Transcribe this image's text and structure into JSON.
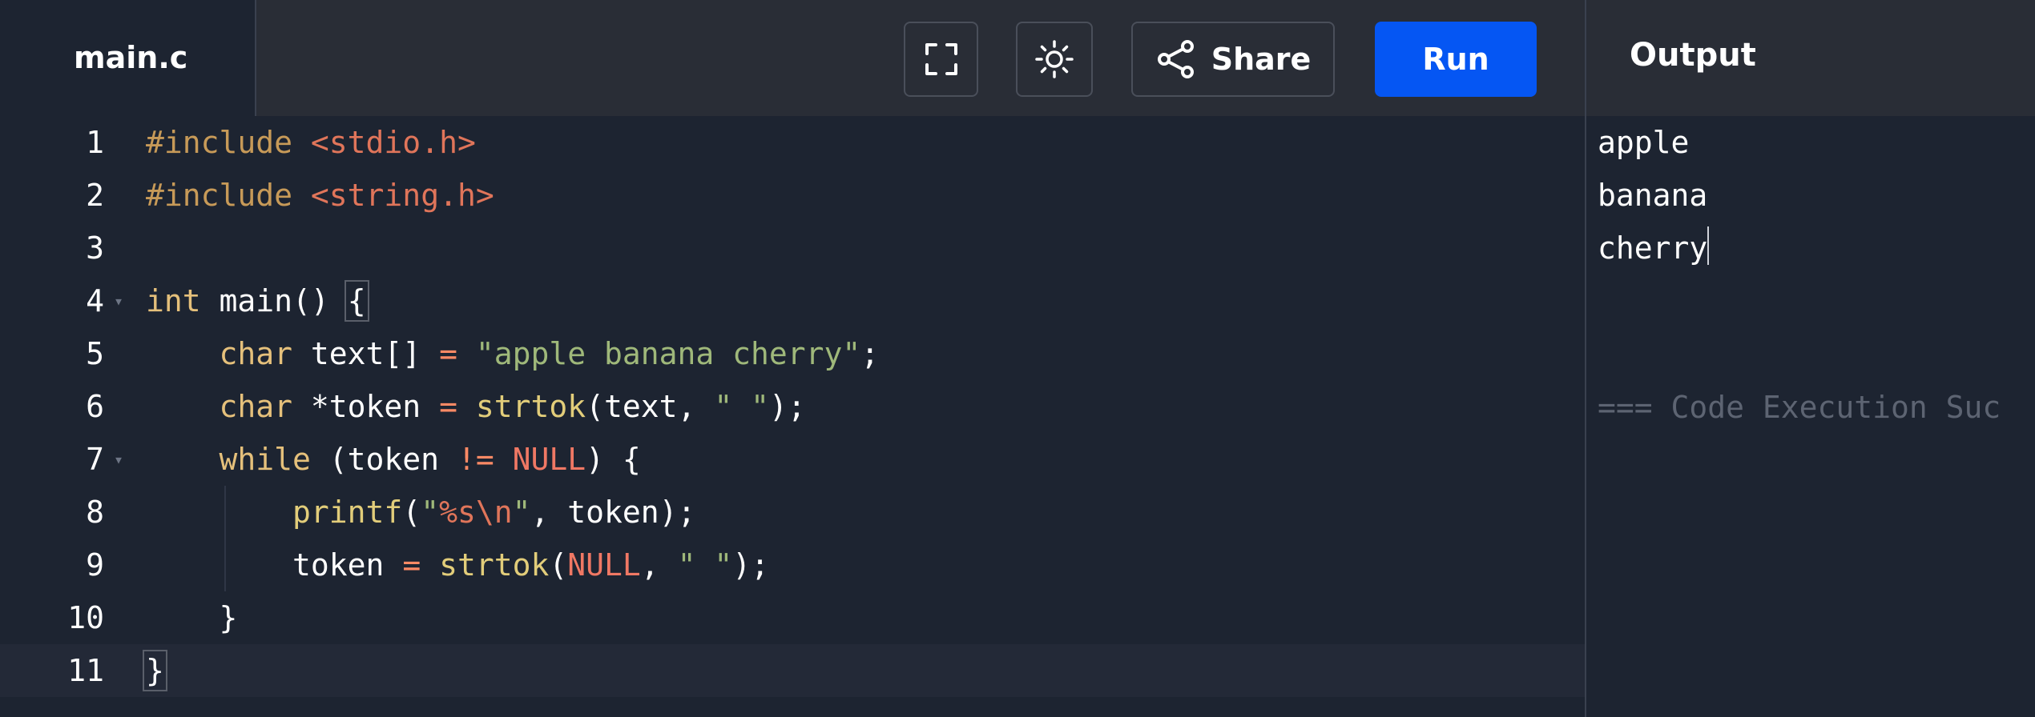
{
  "header": {
    "file_tab": "main.c",
    "share_label": "Share",
    "run_label": "Run"
  },
  "icons": {
    "fullscreen": "fullscreen-icon",
    "theme": "sun-icon",
    "share": "share-icon"
  },
  "colors": {
    "run_button": "#0556f3",
    "editor_bg": "#1d2431",
    "toolbar_bg": "#292d36"
  },
  "editor": {
    "line_numbers": [
      "1",
      "2",
      "3",
      "4",
      "5",
      "6",
      "7",
      "8",
      "9",
      "10",
      "11"
    ],
    "lines": {
      "l1": {
        "kw": "#include",
        "hdr": "<stdio.h>"
      },
      "l2": {
        "kw": "#include",
        "hdr": "<string.h>"
      },
      "l4": {
        "type": "int",
        "rest": "main()",
        "brace": "{"
      },
      "l5": {
        "type": "char",
        "mid": "text[]",
        "op": "=",
        "str": "\"apple banana cherry\"",
        "end": ";"
      },
      "l6": {
        "type": "char",
        "mid": "*token",
        "op": "=",
        "fn": "strtok",
        "args1": "(text,",
        "str": "\" \"",
        "end": ");"
      },
      "l7": {
        "kw": "while",
        "a": "(token",
        "op": "!=",
        "null": "NULL",
        "b": ") {"
      },
      "l8": {
        "fn": "printf",
        "a": "(",
        "q1": "\"",
        "esc": "%s\\n",
        "q2": "\"",
        "b": ", token);"
      },
      "l9": {
        "a": "token",
        "op": "=",
        "fn": "strtok",
        "b": "(",
        "null": "NULL",
        "c": ",",
        "str": "\" \"",
        "d": ");"
      },
      "l10": {
        "a": "}"
      },
      "l11": {
        "a": "}"
      }
    }
  },
  "output": {
    "title": "Output",
    "lines": [
      "apple",
      "banana",
      "cherry"
    ],
    "status": "=== Code Execution Suc"
  }
}
